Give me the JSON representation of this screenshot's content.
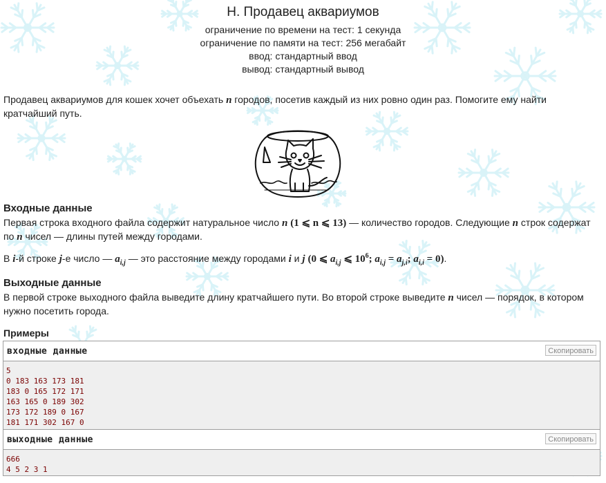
{
  "problem": {
    "title": "H. Продавец аквариумов",
    "limits": [
      "ограничение по времени на тест: 1 секунда",
      "ограничение по памяти на тест: 256 мегабайт",
      "ввод: стандартный ввод",
      "вывод: стандартный вывод"
    ]
  },
  "legend": {
    "s1": "Продавец аквариумов для кошек хочет объехать ",
    "n": "n",
    "s2": " городов, посетив каждый из них ровно один раз. Помогите ему найти кратчайший путь."
  },
  "input_section": {
    "heading": "Входные данные",
    "p1a": "Первая строка входного файла содержит натуральное число ",
    "p1_n": "n",
    "p1_cond": "(1 ⩽ n ⩽ 13)",
    "p1b": " — количество городов. Следующие ",
    "p1_n2": "n",
    "p1c": " строк содержат по ",
    "p1_n3": "n",
    "p1d": " чисел — длины путей между городами.",
    "p2a": "В ",
    "p2_i": "i",
    "p2b": "-й строке ",
    "p2_j": "j",
    "p2c": "-е число — ",
    "p2_a": "a",
    "p2_asub": "i,j",
    "p2d": " — это расстояние между городами ",
    "p2_i2": "i",
    "p2e": " и ",
    "p2_j2": "j",
    "p2f": " ",
    "p2_cond1": "(0 ⩽ ",
    "p2_cond2": " ⩽ 10",
    "p2_exp": "6",
    "p2_cond3": "; ",
    "p2_cond4": " = ",
    "p2_cond5": "; ",
    "p2_cond6": " = 0)",
    "p2_end": "."
  },
  "output_section": {
    "heading": "Выходные данные",
    "p1a": "В первой строке выходного файла выведите длину кратчайшего пути. Во второй строке выведите ",
    "p1_n": "n",
    "p1b": " чисел — порядок, в котором нужно посетить города."
  },
  "examples": {
    "title": "Примеры",
    "input_label": "входные данные",
    "output_label": "выходные данные",
    "copy_label": "Скопировать",
    "input_text": "5\n0 183 163 173 181\n183 0 165 172 171\n163 165 0 189 302\n173 172 189 0 167\n181 171 302 167 0",
    "output_text": "666\n4 5 2 3 1"
  },
  "colors": {
    "snow": "#c9eef6",
    "sample_text": "#7a0000",
    "box_border": "#9e9e9e"
  },
  "icons": {
    "image": "cat-in-aquarium-illustration",
    "background": "snowflake-pattern"
  }
}
